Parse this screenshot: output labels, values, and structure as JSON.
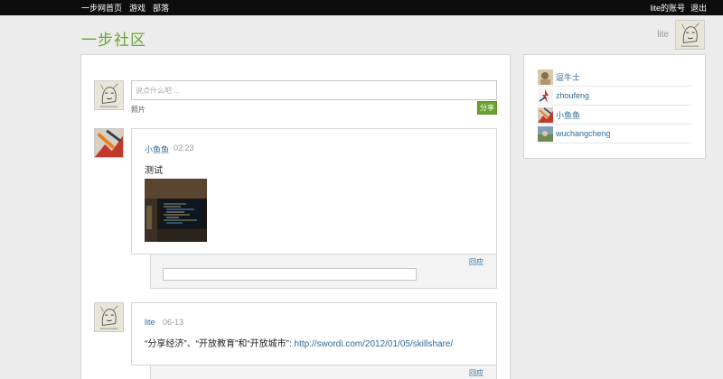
{
  "topbar": {
    "nav": [
      "一步网首页",
      "游戏",
      "部落"
    ],
    "account": "lite的账号",
    "logout": "退出"
  },
  "header": {
    "site_title": "一步社区",
    "username": "lite"
  },
  "composer": {
    "placeholder": "说点什么吧 ...",
    "photo_label": "照片",
    "share_label": "分享"
  },
  "posts": [
    {
      "author": "小鱼鱼",
      "time": "02:23",
      "text": "测试",
      "reply_label": "回应"
    },
    {
      "author": "lite",
      "time": "06-13",
      "text": "“分享经济”、“开放教育”和“开放城市”: ",
      "link": "http://swordi.com/2012/01/05/skillshare/",
      "reply_label": "回应"
    }
  ],
  "sidebar": {
    "users": [
      "逗牛士",
      "zhoufeng",
      "小鱼鱼",
      "wuchangcheng"
    ]
  },
  "colors": {
    "brand_green": "#6aa42c",
    "link_blue": "#2f6b9a",
    "topbar_black": "#0d0d0d"
  }
}
